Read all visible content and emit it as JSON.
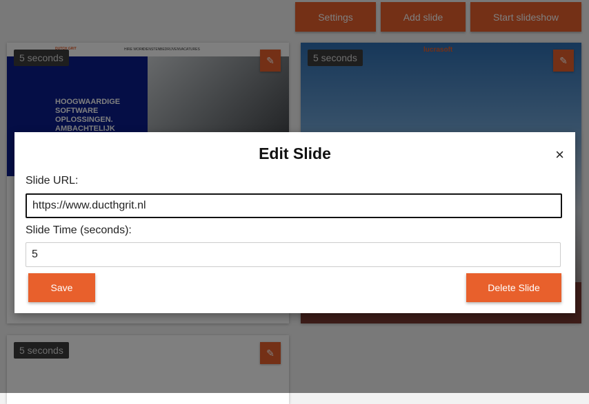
{
  "toolbar": {
    "settings_label": "Settings",
    "add_slide_label": "Add slide",
    "start_slideshow_label": "Start slideshow"
  },
  "slides": [
    {
      "time_label": "5 seconds",
      "hero_text": "HOOGWAARDIGE\nSOFTWARE\nOPLOSSINGEN.\nAMBACHTELIJK",
      "nav_items": [
        "HIRE WORK",
        "DIENSTEN",
        "BEDRIJVEN",
        "VACATURES"
      ],
      "brand": "DUTCH GRIT"
    },
    {
      "time_label": "5 seconds",
      "brand": "lucrasoft"
    },
    {
      "time_label": "5 seconds"
    }
  ],
  "modal": {
    "title": "Edit Slide",
    "close_symbol": "×",
    "url_label": "Slide URL:",
    "url_value": "https://www.ducthgrit.nl",
    "time_label": "Slide Time (seconds):",
    "time_value": "5",
    "save_label": "Save",
    "delete_label": "Delete Slide"
  },
  "colors": {
    "accent": "#e8602c",
    "overlay": "rgba(0,0,0,0.5)"
  },
  "icons": {
    "edit": "pencil-icon",
    "close": "close-icon"
  }
}
